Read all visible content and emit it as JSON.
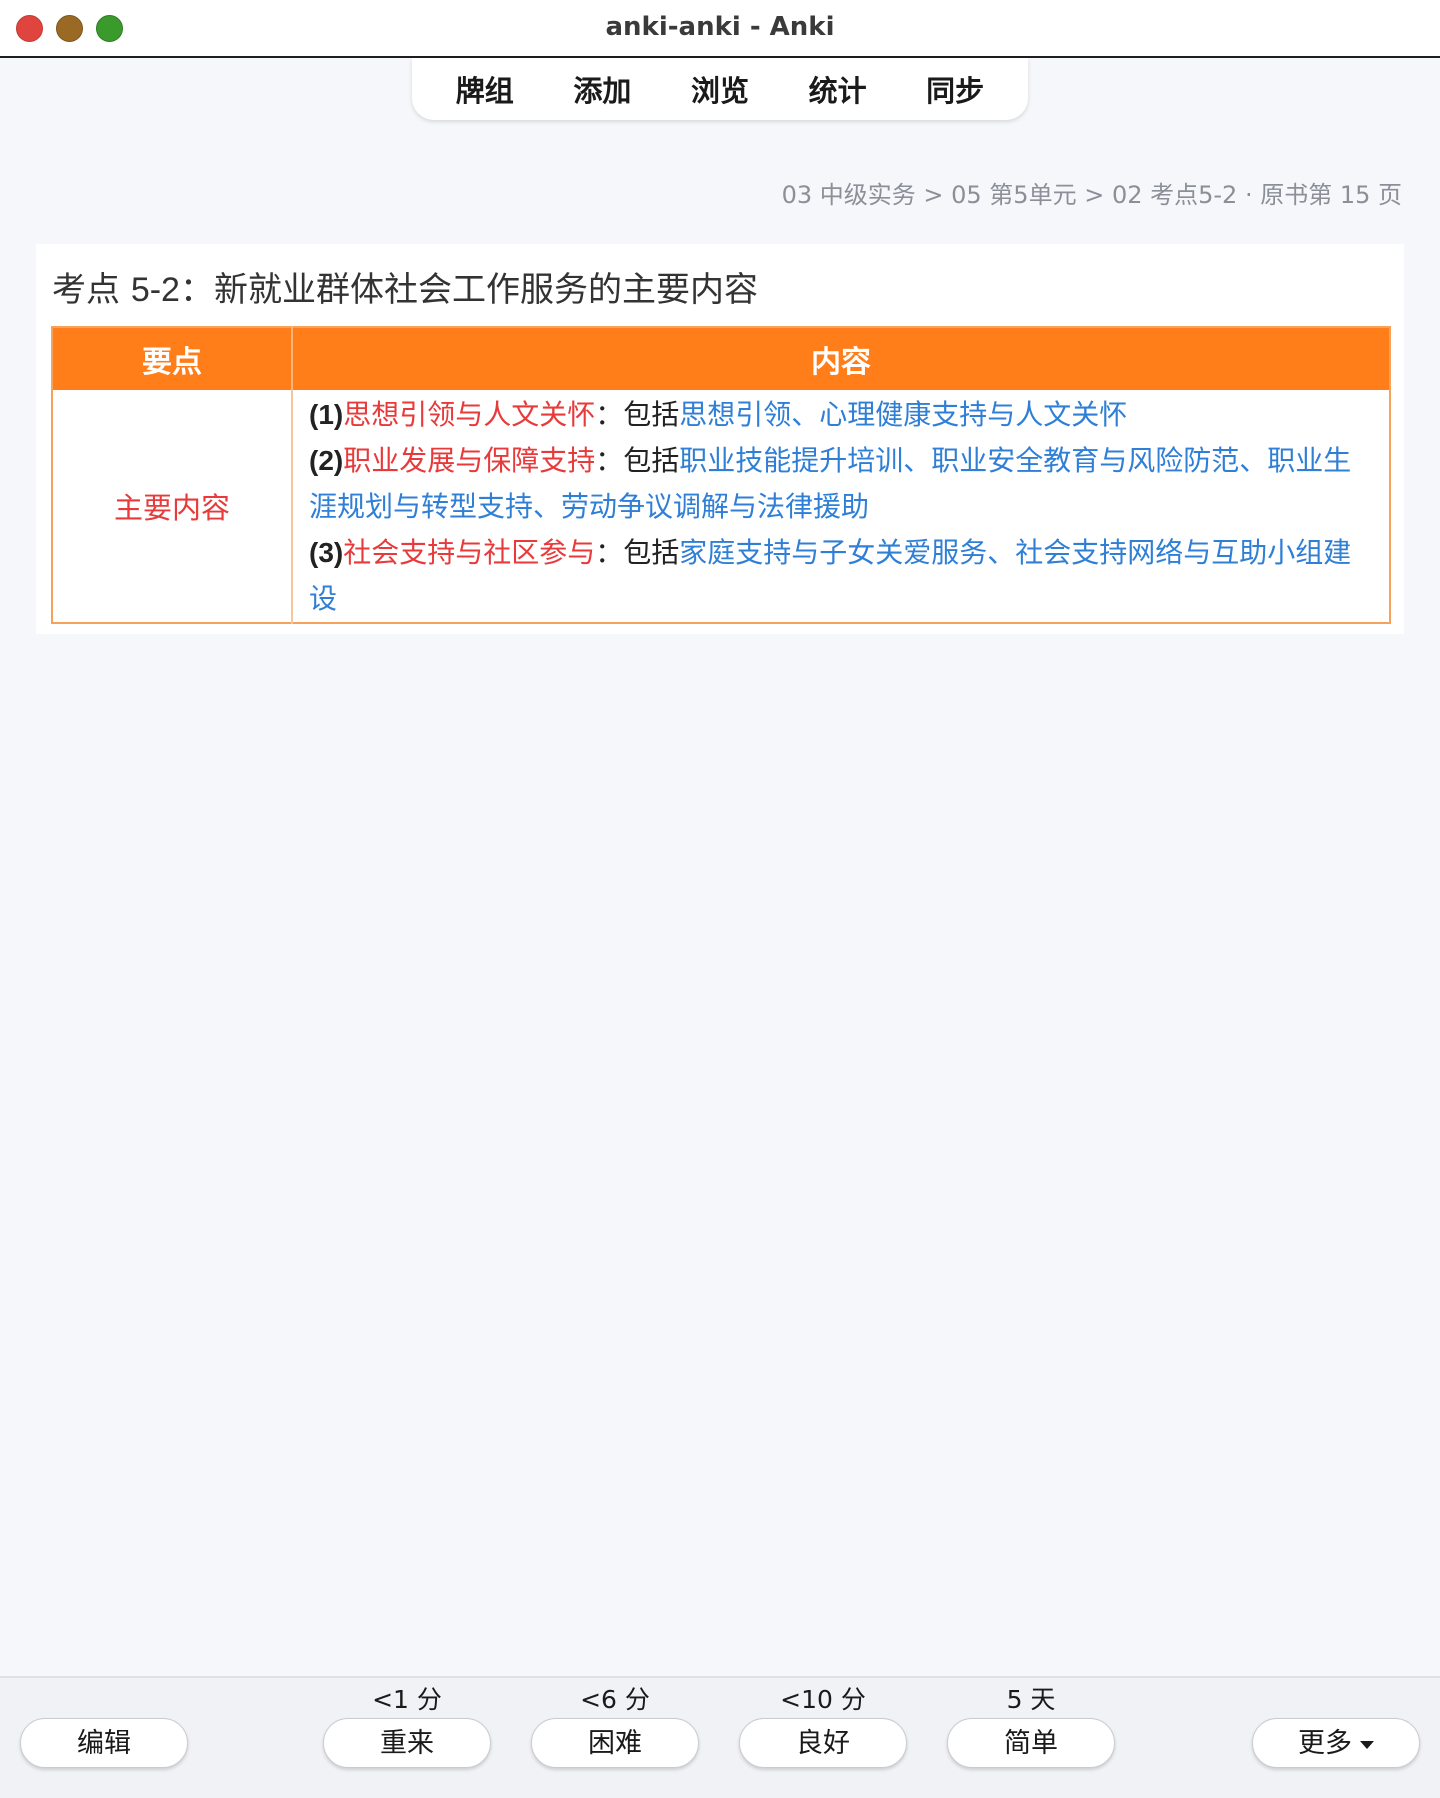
{
  "window": {
    "title": "anki-anki - Anki"
  },
  "toolbar": {
    "items": [
      "牌组",
      "添加",
      "浏览",
      "统计",
      "同步"
    ]
  },
  "breadcrumb": "03 中级实务 > 05 第5单元 > 02 考点5-2 · 原书第 15 页",
  "card": {
    "title_prefix": "考点 ",
    "title_num": "5-2",
    "title_rest": "：新就业群体社会工作服务的主要内容",
    "table": {
      "headers": [
        "要点",
        "内容"
      ],
      "row_label": "主要内容",
      "items": [
        {
          "idx": "(1)",
          "topic": "思想引领与人文关怀",
          "sep": "：包括",
          "detail": "思想引领、心理健康支持与人文关怀"
        },
        {
          "idx": "(2)",
          "topic": "职业发展与保障支持",
          "sep": "：包括",
          "detail": "职业技能提升培训、职业安全教育与风险防范、职业生涯规划与转型支持、劳动争议调解与法律援助"
        },
        {
          "idx": "(3)",
          "topic": "社会支持与社区参与",
          "sep": "：包括",
          "detail": "家庭支持与子女关爱服务、社会支持网络与互助小组建设"
        }
      ]
    }
  },
  "review": {
    "edit_label": "编辑",
    "more_label": "更多",
    "answers": [
      {
        "interval": "<1 分",
        "label": "重来"
      },
      {
        "interval": "<6 分",
        "label": "困难"
      },
      {
        "interval": "<10 分",
        "label": "良好"
      },
      {
        "interval": "5 天",
        "label": "简单"
      }
    ]
  }
}
